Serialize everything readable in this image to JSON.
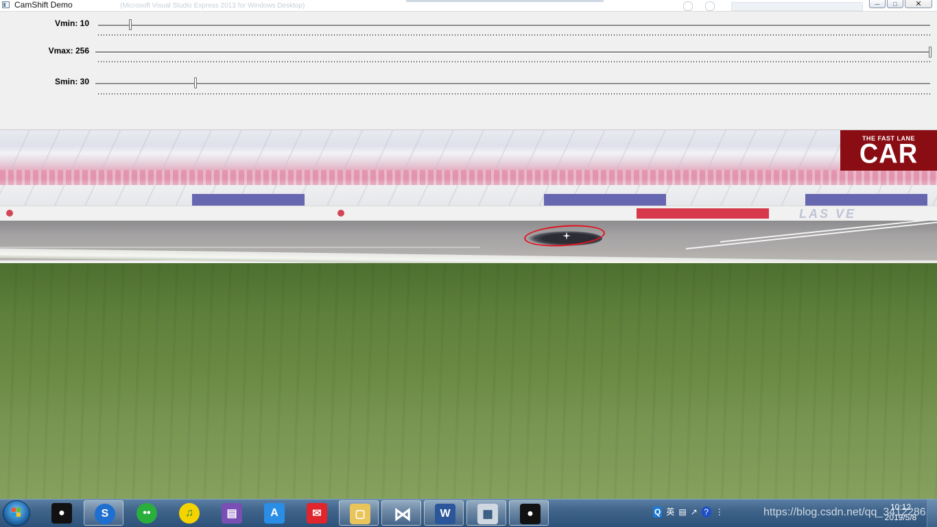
{
  "window": {
    "title": "CamShift Demo",
    "ghost_title": "(Microsoft Visual Studio Express 2013 for Windows Desktop)"
  },
  "trackbars": [
    {
      "label": "Vmin: 10",
      "value": 10,
      "max": 256
    },
    {
      "label": "Vmax: 256",
      "value": 256,
      "max": 256
    },
    {
      "label": "Smin: 30",
      "value": 30,
      "max": 256
    }
  ],
  "video": {
    "logo_top": "THE FAST LANE",
    "logo_main": "CAR",
    "wall_text": "LAS VE",
    "tracking_color": "#e4101e"
  },
  "taskbar": {
    "apps": [
      {
        "name": "qq-icon",
        "color": "#111111"
      },
      {
        "name": "sogou-icon",
        "color": "#1f6fd0"
      },
      {
        "name": "wechat-icon",
        "color": "#2aae3c"
      },
      {
        "name": "qq-music-icon",
        "color": "#f5d300"
      },
      {
        "name": "books-icon",
        "color": "#7a4fb5"
      },
      {
        "name": "translate-icon",
        "color": "#2a8ee6"
      },
      {
        "name": "mail-icon",
        "color": "#e0262c"
      },
      {
        "name": "file-explorer-icon",
        "color": "#e9c45a"
      },
      {
        "name": "visual-studio-icon",
        "color": "#5c2d91"
      },
      {
        "name": "word-icon",
        "color": "#2b579a"
      },
      {
        "name": "camshift-window-icon",
        "color": "#cfd7e0"
      },
      {
        "name": "qq-running-icon",
        "color": "#111111"
      }
    ],
    "ime_label": "英",
    "watermark": "https://blog.csdn.net/qq_34122861",
    "time": "10:12",
    "date": "2019/5/8"
  }
}
